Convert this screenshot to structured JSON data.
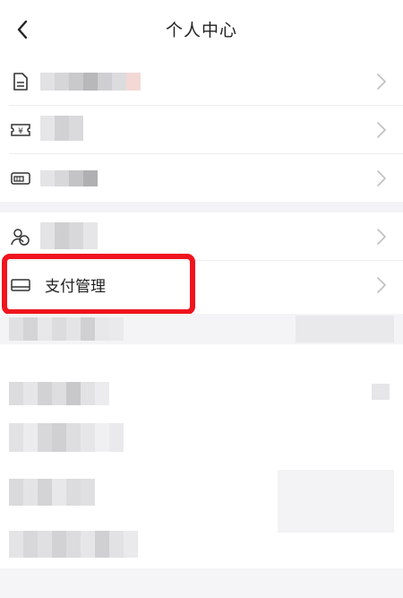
{
  "navbar": {
    "title": "个人中心",
    "back_icon": "chevron-left-icon"
  },
  "menu_items": [
    {
      "icon": "document-icon",
      "label": ""
    },
    {
      "icon": "yuan-ticket-icon",
      "label": ""
    },
    {
      "icon": "wallet-card-icon",
      "label": ""
    },
    {
      "icon": "users-icon",
      "label": ""
    },
    {
      "icon": "bank-card-icon",
      "label": "支付管理"
    }
  ],
  "colors": {
    "highlight": "#f0141e",
    "separator": "#ededed",
    "section_gap": "#f3f3f5",
    "chevron": "#bfbfbf"
  }
}
